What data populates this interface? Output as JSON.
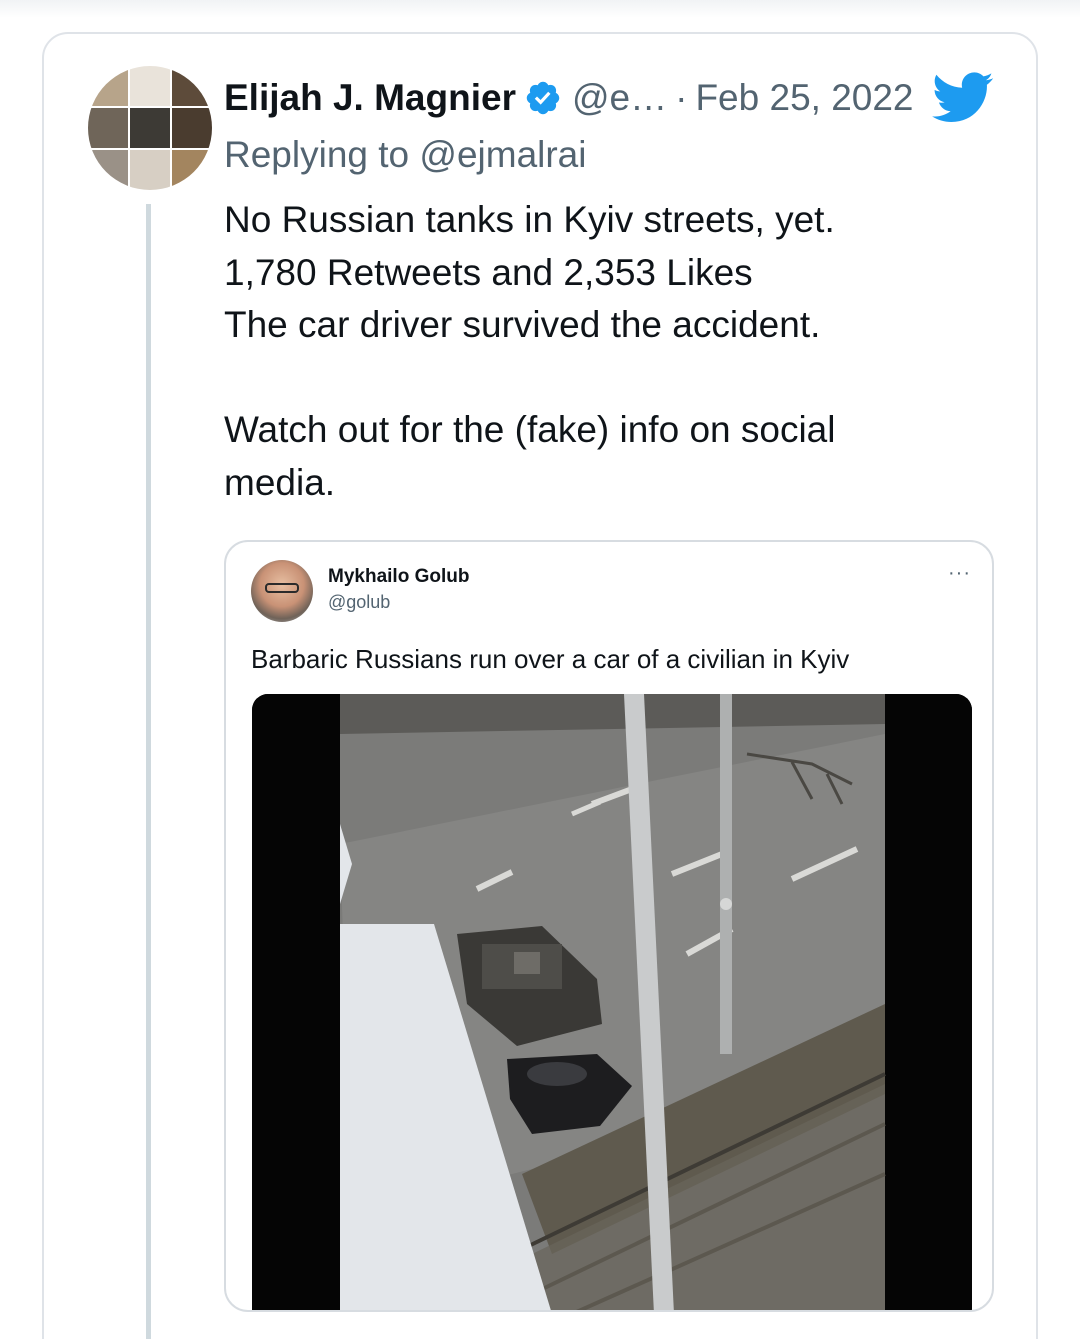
{
  "tweet": {
    "author_name": "Elijah J. Magnier",
    "handle": "@e…",
    "separator": "·",
    "date": "Feb 25, 2022",
    "replying_to": "Replying to @ejmalrai",
    "lines": [
      "No Russian tanks in Kyiv streets, yet.",
      "1,780 Retweets and 2,353 Likes",
      "The car driver survived the accident.",
      "Watch out for the (fake) info on social",
      "media."
    ],
    "icons": {
      "verified": "verified-badge-icon",
      "brand": "twitter-bird-icon"
    }
  },
  "quoted_tweet": {
    "author_name": "Mykhailo Golub",
    "handle": "@golub",
    "more": "···",
    "text": "Barbaric Russians run over a car of a civilian in Kyiv",
    "media": "video-thumbnail"
  },
  "colors": {
    "brand_blue": "#1d9bf0",
    "text": "#0f1419",
    "secondary": "#536471",
    "border": "#dfe3e8"
  }
}
